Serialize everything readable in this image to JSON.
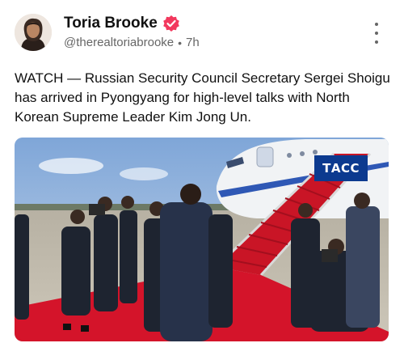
{
  "post": {
    "author_name": "Toria Brooke",
    "handle": "@therealtoriabrooke",
    "separator": "•",
    "time_ago": "7h",
    "text": "WATCH — Russian Security Council Secretary Sergei Shoigu has arrived in Pyongyang for high-level talks with North Korean Supreme Leader Kim Jong Un."
  },
  "media": {
    "watermark": "ТАСС"
  },
  "icons": {
    "verified": "verified-badge-icon",
    "more": "more-options-icon"
  },
  "colors": {
    "verified_badge": "#f2385d",
    "watermark_bg": "#0c3a8f",
    "carpet": "#d4142a"
  }
}
